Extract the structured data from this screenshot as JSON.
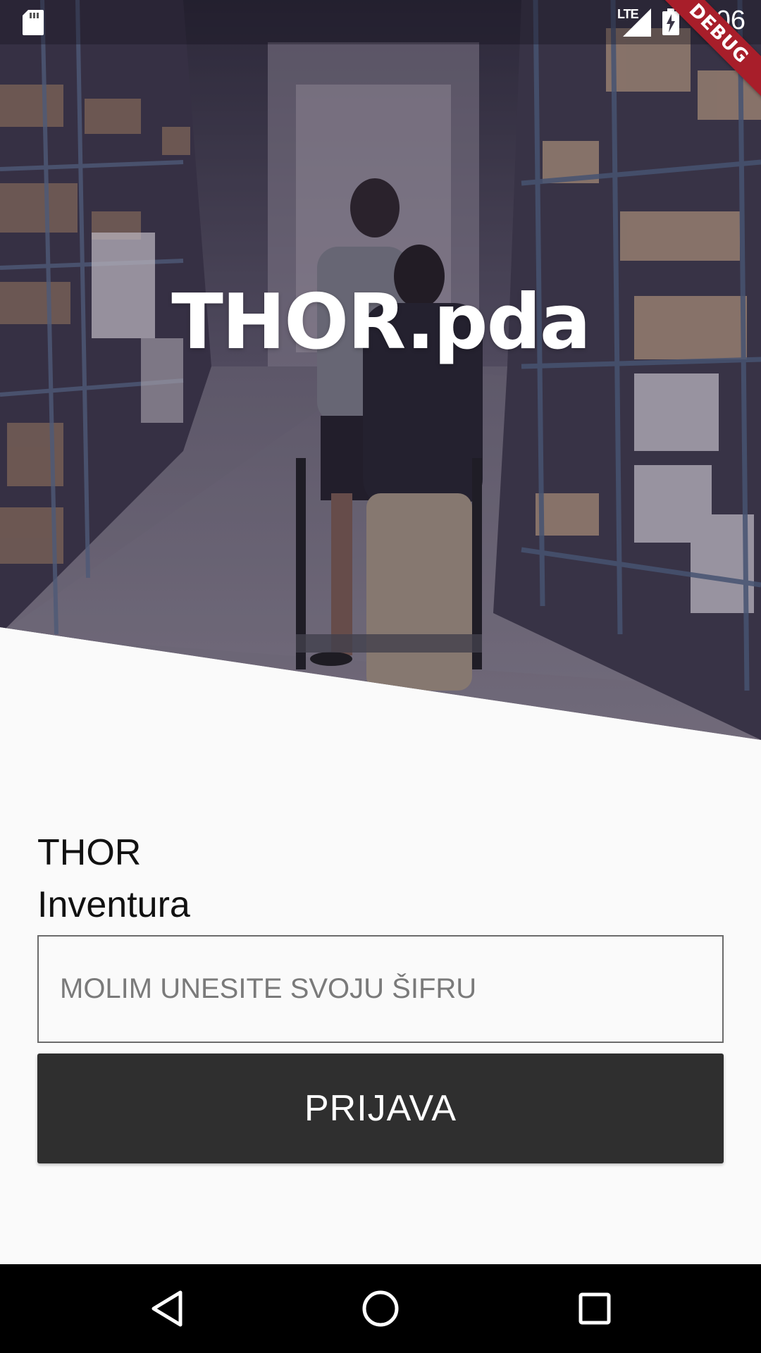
{
  "status_bar": {
    "network": "LTE",
    "time": "3:06",
    "debug_banner": "DEBUG",
    "icons": [
      "sd-card-icon",
      "signal-icon",
      "battery-charging-icon"
    ]
  },
  "hero": {
    "title": "THOR.pda"
  },
  "form": {
    "app_name": "THOR",
    "module_name": "Inventura",
    "password_placeholder": "MOLIM UNESITE SVOJU ŠIFRU",
    "password_value": "",
    "login_label": "PRIJAVA"
  },
  "nav_bar": {
    "icons": [
      "back-icon",
      "home-icon",
      "recents-icon"
    ]
  },
  "colors": {
    "background": "#fafafa",
    "button": "#2f2f2f",
    "debug_ribbon": "#a81e2a",
    "input_border": "#6b6b6b"
  }
}
